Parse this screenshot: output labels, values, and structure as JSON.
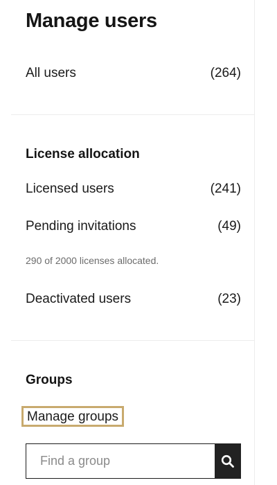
{
  "page": {
    "title": "Manage users"
  },
  "all_users": {
    "label": "All users",
    "count": "(264)"
  },
  "license_allocation": {
    "heading": "License allocation",
    "licensed_users": {
      "label": "Licensed users",
      "count": "(241)"
    },
    "pending_invitations": {
      "label": "Pending invitations",
      "count": "(49)"
    },
    "note": "290 of 2000 licenses allocated.",
    "deactivated_users": {
      "label": "Deactivated users",
      "count": "(23)"
    }
  },
  "groups": {
    "heading": "Groups",
    "manage_link": "Manage groups",
    "search": {
      "placeholder": "Find a group",
      "value": "",
      "button_icon": "search-icon"
    }
  },
  "colors": {
    "focus_outline": "#c8aa6e",
    "search_button_bg": "#222222",
    "note_text": "#6b6b6b",
    "divider": "#ececec"
  }
}
